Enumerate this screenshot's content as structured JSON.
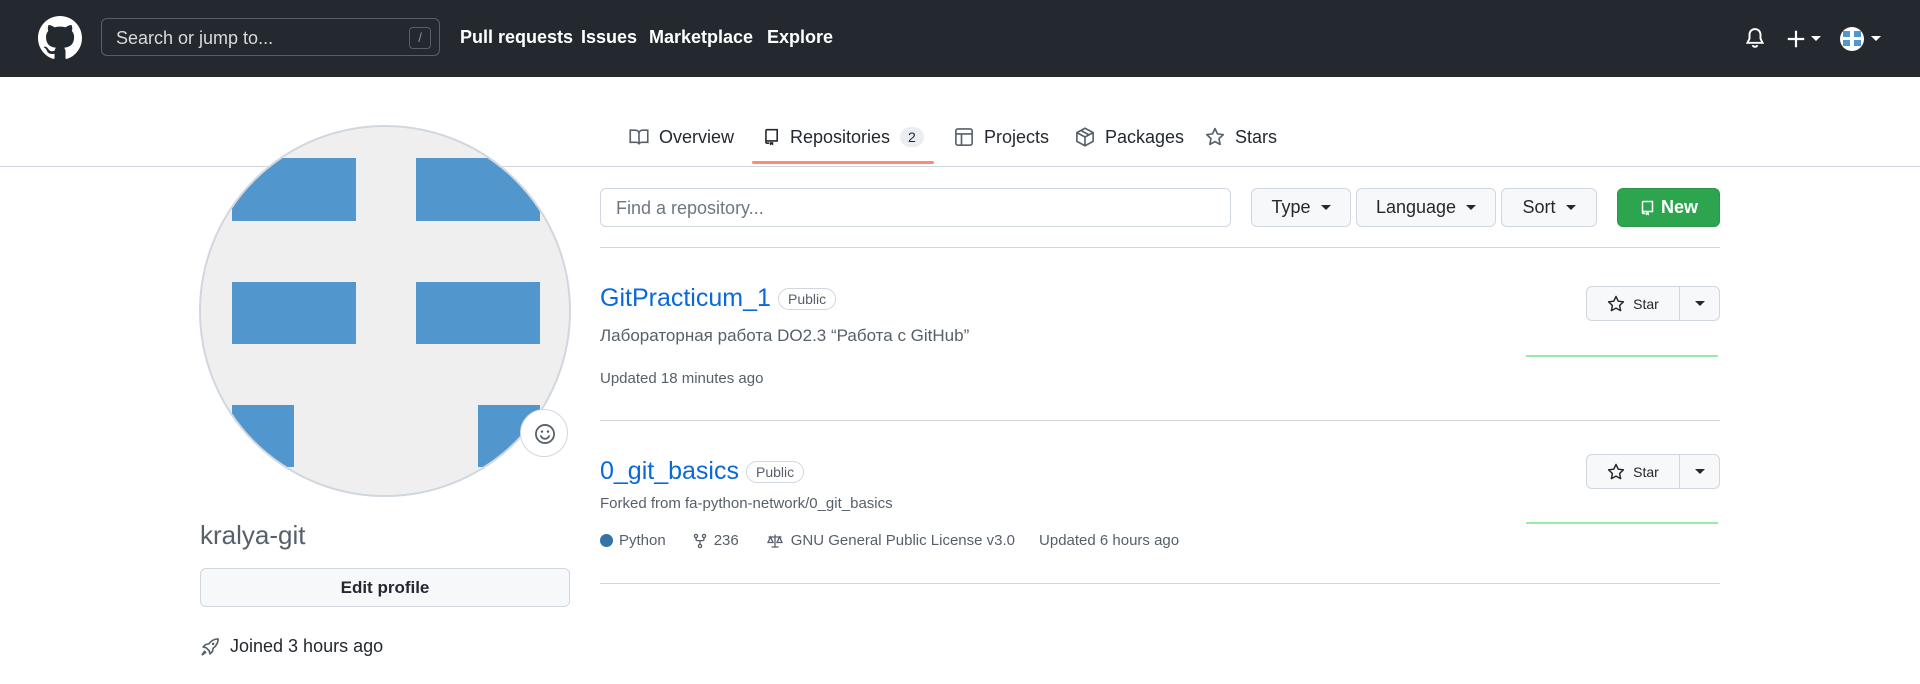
{
  "header": {
    "search_placeholder": "Search or jump to...",
    "search_shortcut": "/",
    "nav": [
      "Pull requests",
      "Issues",
      "Marketplace",
      "Explore"
    ]
  },
  "tabs": [
    {
      "label": "Overview"
    },
    {
      "label": "Repositories",
      "count": "2"
    },
    {
      "label": "Projects"
    },
    {
      "label": "Packages"
    },
    {
      "label": "Stars"
    }
  ],
  "profile": {
    "username": "kralya-git",
    "edit_button": "Edit profile",
    "joined": "Joined 3 hours ago",
    "avatar_color": "#5196cc"
  },
  "filters": {
    "search_placeholder": "Find a repository...",
    "type": "Type",
    "language": "Language",
    "sort": "Sort",
    "new": "New"
  },
  "repos": [
    {
      "name": "GitPracticum_1",
      "visibility": "Public",
      "description": "Лабораторная работа DO2.3 “Работа с GitHub”",
      "updated": "Updated 18 minutes ago",
      "star": "Star"
    },
    {
      "name": "0_git_basics",
      "visibility": "Public",
      "forked_from": "Forked from fa-python-network/0_git_basics",
      "language": "Python",
      "forks": "236",
      "license": "GNU General Public License v3.0",
      "updated": "Updated 6 hours ago",
      "star": "Star"
    }
  ],
  "colors": {
    "header_bg": "#24292f",
    "link": "#0969da",
    "new_button": "#2da44e",
    "tab_underline": "#fd8c73",
    "python": "#3572a5"
  }
}
